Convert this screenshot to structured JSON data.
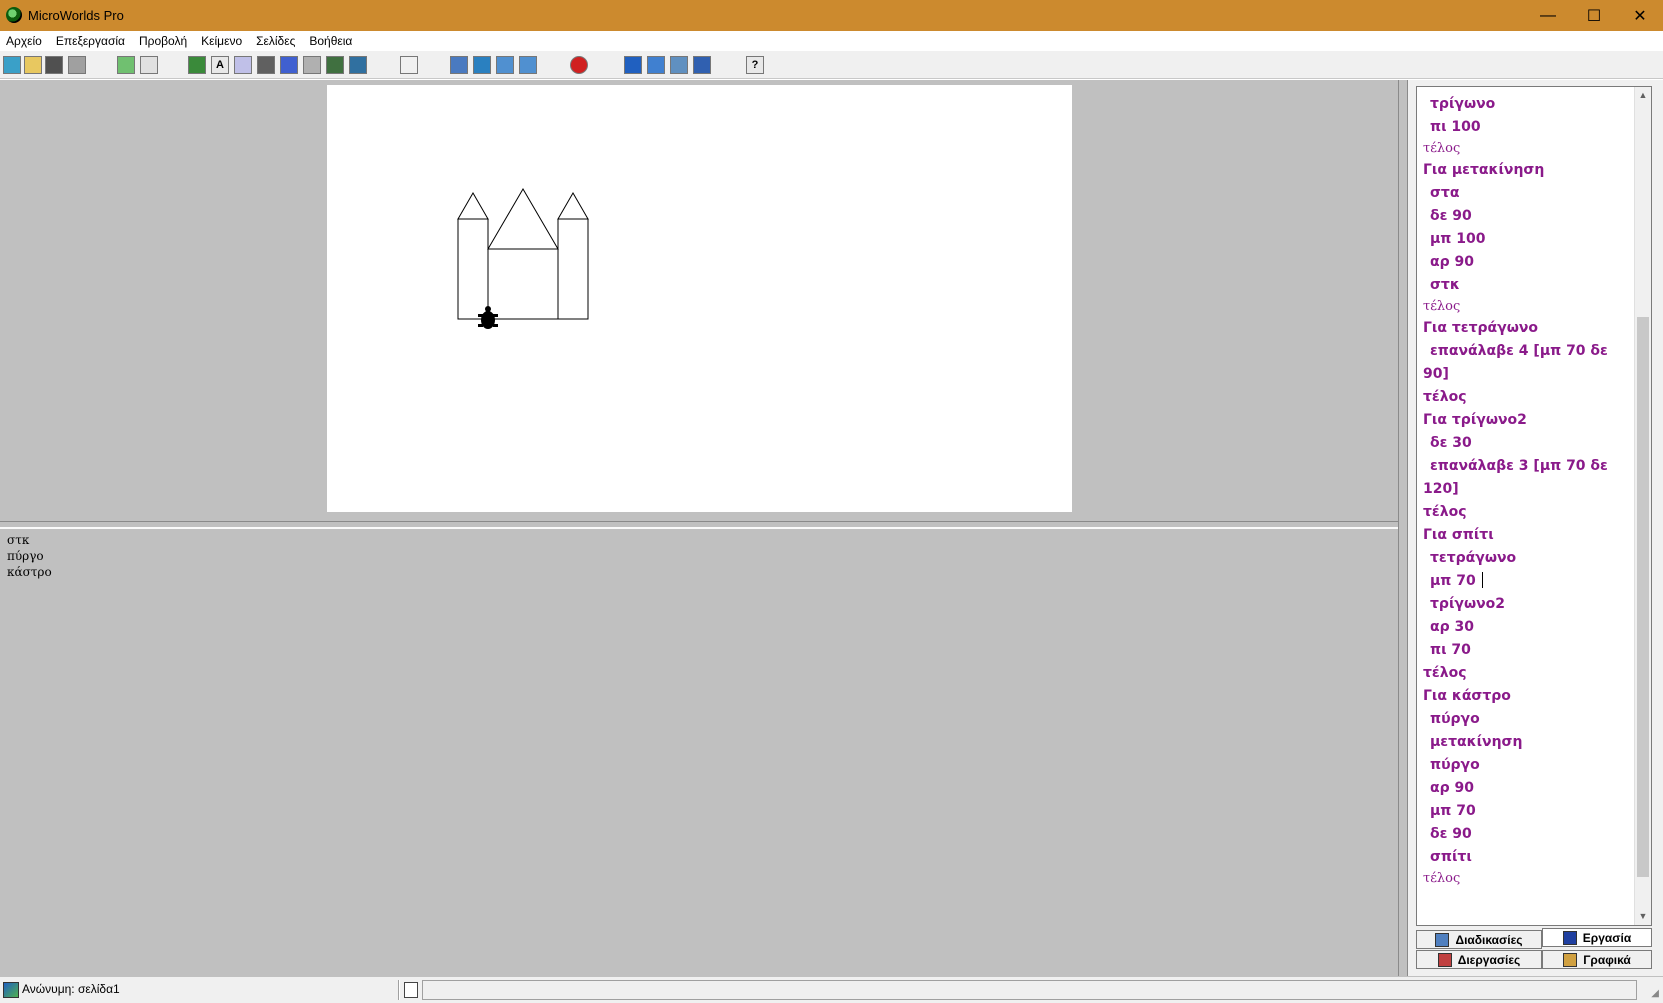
{
  "window": {
    "title": "MicroWorlds Pro",
    "minimize_icon": "minimize-icon",
    "maximize_icon": "maximize-icon",
    "close_icon": "close-icon",
    "minimize_glyph": "—",
    "maximize_glyph": "☐",
    "close_glyph": "✕"
  },
  "menu": [
    "Αρχείο",
    "Επεξεργασία",
    "Προβολή",
    "Κείμενο",
    "Σελίδες",
    "Βοήθεια"
  ],
  "toolbar": {
    "icons": [
      "new-project-icon",
      "open-icon",
      "save-icon",
      "print-icon",
      "page-view-icon",
      "page-list-icon",
      "hatch-turtle-icon",
      "text-box-icon",
      "paint-icon",
      "eye-icon",
      "music-icon",
      "tool-icon",
      "video-icon",
      "slider-icon",
      "pointer-icon",
      "eye-tool-icon",
      "stamp-icon",
      "zoom-in-icon",
      "zoom-out-icon",
      "stop-icon",
      "cut-icon",
      "copy-icon",
      "paste-icon",
      "undo-icon",
      "help-icon"
    ],
    "help_glyph": "?",
    "text_glyph": "A"
  },
  "command_center": {
    "lines": [
      "στκ",
      "πύργο",
      "κάστρο"
    ]
  },
  "procedures": {
    "lines": [
      {
        "text": "τρίγωνο",
        "kind": "code",
        "indent": true
      },
      {
        "text": "πι 100",
        "kind": "code",
        "indent": true
      },
      {
        "text": "τέλος",
        "kind": "end",
        "indent": false
      },
      {
        "text": "Για μετακίνηση",
        "kind": "code",
        "indent": false
      },
      {
        "text": "στα",
        "kind": "code",
        "indent": true
      },
      {
        "text": "δε 90",
        "kind": "code",
        "indent": true
      },
      {
        "text": "μπ 100",
        "kind": "code",
        "indent": true
      },
      {
        "text": "αρ 90",
        "kind": "code",
        "indent": true
      },
      {
        "text": "στκ",
        "kind": "code",
        "indent": true
      },
      {
        "text": "τέλος",
        "kind": "end",
        "indent": false
      },
      {
        "text": "Για τετράγωνο",
        "kind": "code",
        "indent": false
      },
      {
        "text": "επανάλαβε  4  [μπ  70  δε",
        "kind": "code",
        "indent": true
      },
      {
        "text": "90]",
        "kind": "code",
        "indent": false
      },
      {
        "text": "τέλος",
        "kind": "code",
        "indent": false
      },
      {
        "text": "Για τρίγωνο2",
        "kind": "code",
        "indent": false
      },
      {
        "text": "δε 30",
        "kind": "code",
        "indent": true
      },
      {
        "text": "επανάλαβε  3  [μπ  70  δε",
        "kind": "code",
        "indent": true
      },
      {
        "text": "120]",
        "kind": "code",
        "indent": false
      },
      {
        "text": "τέλος",
        "kind": "code",
        "indent": false
      },
      {
        "text": "Για σπίτι",
        "kind": "code",
        "indent": false
      },
      {
        "text": "τετράγωνο",
        "kind": "code",
        "indent": true
      },
      {
        "text": "μπ 70",
        "kind": "code",
        "indent": true,
        "caret": true
      },
      {
        "text": "τρίγωνο2",
        "kind": "code",
        "indent": true
      },
      {
        "text": "αρ 30",
        "kind": "code",
        "indent": true
      },
      {
        "text": "πι 70",
        "kind": "code",
        "indent": true
      },
      {
        "text": "τέλος",
        "kind": "code",
        "indent": false
      },
      {
        "text": "Για κάστρο",
        "kind": "code",
        "indent": false
      },
      {
        "text": "πύργο",
        "kind": "code",
        "indent": true
      },
      {
        "text": "μετακίνηση",
        "kind": "code",
        "indent": true
      },
      {
        "text": "πύργο",
        "kind": "code",
        "indent": true
      },
      {
        "text": "αρ 90",
        "kind": "code",
        "indent": true
      },
      {
        "text": "μπ 70",
        "kind": "code",
        "indent": true
      },
      {
        "text": "δε 90",
        "kind": "code",
        "indent": true
      },
      {
        "text": "σπίτι",
        "kind": "code",
        "indent": true
      },
      {
        "text": "τέλος",
        "kind": "end",
        "indent": false
      }
    ],
    "text_color": "#8a1a8a",
    "scroll_up_glyph": "▲",
    "scroll_down_glyph": "▼"
  },
  "tabs": {
    "procedures": "Διαδικασίες",
    "project": "Εργασία",
    "processes": "Διεργασίες",
    "graphics": "Γραφικά"
  },
  "statusbar": {
    "text": "Ανώνυμη:  σελίδα1",
    "grip_glyph": "◢"
  },
  "colors": {
    "titlebar": "#cc8a2e",
    "workspace": "#c0c0c0",
    "procedure_text": "#8a1a8a"
  }
}
